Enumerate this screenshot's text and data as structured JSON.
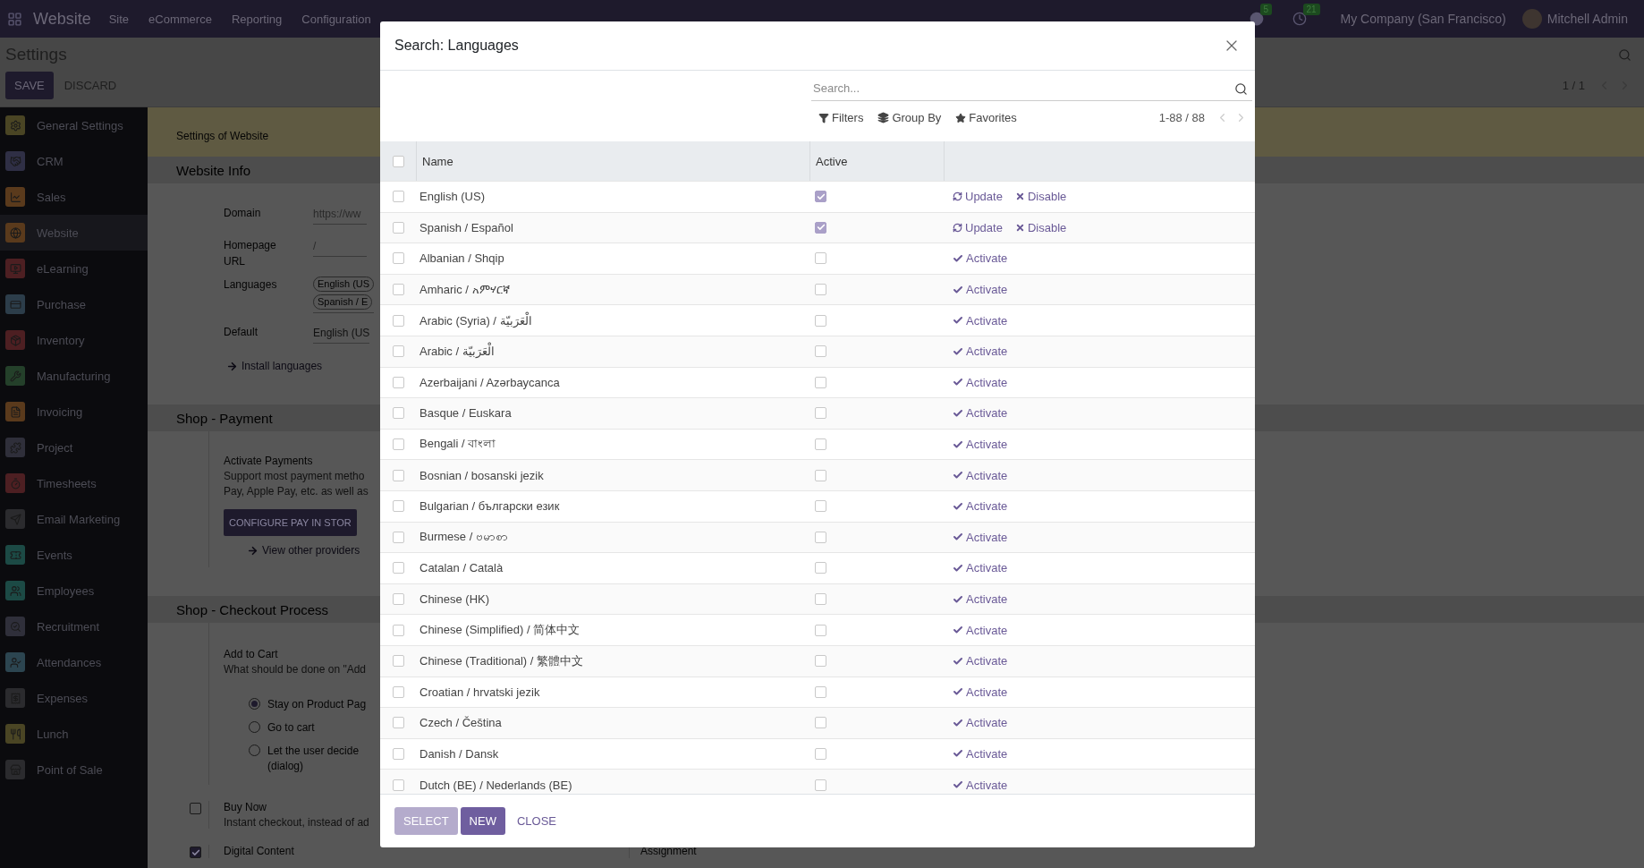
{
  "navbar": {
    "app": "Website",
    "menus": [
      "Site",
      "eCommerce",
      "Reporting",
      "Configuration"
    ],
    "messages_count": "5",
    "activities_count": "21",
    "company": "My Company (San Francisco)",
    "user": "Mitchell Admin"
  },
  "control_panel": {
    "title": "Settings",
    "save": "SAVE",
    "discard": "DISCARD",
    "pager": "1 / 1"
  },
  "sidebar": {
    "items": [
      {
        "label": "General Settings",
        "color": "#4a4524",
        "selected": false
      },
      {
        "label": "CRM",
        "color": "#2f2f45",
        "selected": false
      },
      {
        "label": "Sales",
        "color": "#5a3a1c",
        "selected": false
      },
      {
        "label": "Website",
        "color": "#5a3a1c",
        "selected": true
      },
      {
        "label": "eLearning",
        "color": "#4d1f22",
        "selected": false
      },
      {
        "label": "Purchase",
        "color": "#2c3d4a",
        "selected": false
      },
      {
        "label": "Inventory",
        "color": "#4d1f22",
        "selected": false
      },
      {
        "label": "Manufacturing",
        "color": "#24402a",
        "selected": false
      },
      {
        "label": "Invoicing",
        "color": "#5a3a1c",
        "selected": false
      },
      {
        "label": "Project",
        "color": "#2f2f3a",
        "selected": false
      },
      {
        "label": "Timesheets",
        "color": "#4d1f22",
        "selected": false
      },
      {
        "label": "Email Marketing",
        "color": "#2b2b2e",
        "selected": false
      },
      {
        "label": "Events",
        "color": "#1c4a45",
        "selected": false
      },
      {
        "label": "Employees",
        "color": "#1c4a45",
        "selected": false
      },
      {
        "label": "Recruitment",
        "color": "#2f2f3a",
        "selected": false
      },
      {
        "label": "Attendances",
        "color": "#2c4550",
        "selected": false
      },
      {
        "label": "Expenses",
        "color": "#2b2b2e",
        "selected": false
      },
      {
        "label": "Lunch",
        "color": "#4a4524",
        "selected": false
      },
      {
        "label": "Point of Sale",
        "color": "#2b2b2e",
        "selected": false
      }
    ]
  },
  "settings": {
    "banner": "Settings of Website",
    "website_info": {
      "title": "Website Info",
      "domain_label": "Domain",
      "domain_placeholder": "https://ww",
      "homepage_label": "Homepage URL",
      "homepage_placeholder": "/",
      "languages_label": "Languages",
      "language_tags": [
        "English (US",
        "Spanish / E"
      ],
      "default_label": "Default",
      "default_value": "English (US",
      "install_link": "Install languages"
    },
    "payment": {
      "title": "Shop - Payment",
      "setting": "Activate Payments",
      "description_lines": [
        "Support most payment metho",
        "Pay, Apple Pay, etc. as well as"
      ],
      "button": "CONFIGURE PAY IN STOR",
      "link": "View other providers"
    },
    "checkout": {
      "title": "Shop - Checkout Process",
      "setting": "Add to Cart",
      "description": "What should be done on \"Add",
      "options": [
        {
          "label": "Stay on Product Pag",
          "selected": true
        },
        {
          "label": "Go to cart",
          "selected": false
        },
        {
          "label": "Let the user decide (dialog)",
          "selected": false
        }
      ]
    },
    "buy_now": {
      "label": "Buy Now",
      "checked": false,
      "description": "Instant checkout, instead of ad"
    },
    "digital_content": {
      "label": "Digital Content",
      "checked": true
    },
    "assignment": {
      "label": "Assignment"
    }
  },
  "dialog": {
    "title": "Search: Languages",
    "search": {
      "placeholder": "Search..."
    },
    "filters": [
      "Filters",
      "Group By",
      "Favorites"
    ],
    "pager": "1-88 / 88",
    "columns": [
      "Name",
      "Active"
    ],
    "all_checked": false,
    "rows": [
      {
        "name": "English (US)",
        "selected": false,
        "active": true,
        "actions": [
          {
            "kind": "update",
            "label": "Update"
          },
          {
            "kind": "disable",
            "label": "Disable"
          }
        ]
      },
      {
        "name": "Spanish / Español",
        "selected": false,
        "active": true,
        "actions": [
          {
            "kind": "update",
            "label": "Update"
          },
          {
            "kind": "disable",
            "label": "Disable"
          }
        ]
      },
      {
        "name": "Albanian / Shqip",
        "selected": false,
        "active": false,
        "actions": [
          {
            "kind": "activate",
            "label": "Activate"
          }
        ]
      },
      {
        "name": "Amharic / አምሃርኛ",
        "selected": false,
        "active": false,
        "actions": [
          {
            "kind": "activate",
            "label": "Activate"
          }
        ]
      },
      {
        "name": "Arabic (Syria) / الْعَرَبيّة",
        "selected": false,
        "active": false,
        "actions": [
          {
            "kind": "activate",
            "label": "Activate"
          }
        ]
      },
      {
        "name": "Arabic / الْعَرَبيّة",
        "selected": false,
        "active": false,
        "actions": [
          {
            "kind": "activate",
            "label": "Activate"
          }
        ]
      },
      {
        "name": "Azerbaijani / Azərbaycanca",
        "selected": false,
        "active": false,
        "actions": [
          {
            "kind": "activate",
            "label": "Activate"
          }
        ]
      },
      {
        "name": "Basque / Euskara",
        "selected": false,
        "active": false,
        "actions": [
          {
            "kind": "activate",
            "label": "Activate"
          }
        ]
      },
      {
        "name": "Bengali / বাংলা",
        "selected": false,
        "active": false,
        "actions": [
          {
            "kind": "activate",
            "label": "Activate"
          }
        ]
      },
      {
        "name": "Bosnian / bosanski jezik",
        "selected": false,
        "active": false,
        "actions": [
          {
            "kind": "activate",
            "label": "Activate"
          }
        ]
      },
      {
        "name": "Bulgarian / български език",
        "selected": false,
        "active": false,
        "actions": [
          {
            "kind": "activate",
            "label": "Activate"
          }
        ]
      },
      {
        "name": "Burmese / ဗမာစာ",
        "selected": false,
        "active": false,
        "actions": [
          {
            "kind": "activate",
            "label": "Activate"
          }
        ]
      },
      {
        "name": "Catalan / Català",
        "selected": false,
        "active": false,
        "actions": [
          {
            "kind": "activate",
            "label": "Activate"
          }
        ]
      },
      {
        "name": "Chinese (HK)",
        "selected": false,
        "active": false,
        "actions": [
          {
            "kind": "activate",
            "label": "Activate"
          }
        ]
      },
      {
        "name": "Chinese (Simplified) / 简体中文",
        "selected": false,
        "active": false,
        "actions": [
          {
            "kind": "activate",
            "label": "Activate"
          }
        ]
      },
      {
        "name": "Chinese (Traditional) / 繁體中文",
        "selected": false,
        "active": false,
        "actions": [
          {
            "kind": "activate",
            "label": "Activate"
          }
        ]
      },
      {
        "name": "Croatian / hrvatski jezik",
        "selected": false,
        "active": false,
        "actions": [
          {
            "kind": "activate",
            "label": "Activate"
          }
        ]
      },
      {
        "name": "Czech / Čeština",
        "selected": false,
        "active": false,
        "actions": [
          {
            "kind": "activate",
            "label": "Activate"
          }
        ]
      },
      {
        "name": "Danish / Dansk",
        "selected": false,
        "active": false,
        "actions": [
          {
            "kind": "activate",
            "label": "Activate"
          }
        ]
      },
      {
        "name": "Dutch (BE) / Nederlands (BE)",
        "selected": false,
        "active": false,
        "actions": [
          {
            "kind": "activate",
            "label": "Activate"
          }
        ]
      }
    ],
    "buttons": [
      {
        "kind": "primary",
        "label": "SELECT",
        "disabled": true
      },
      {
        "kind": "primary",
        "label": "NEW",
        "disabled": false
      },
      {
        "kind": "link",
        "label": "CLOSE"
      }
    ]
  }
}
